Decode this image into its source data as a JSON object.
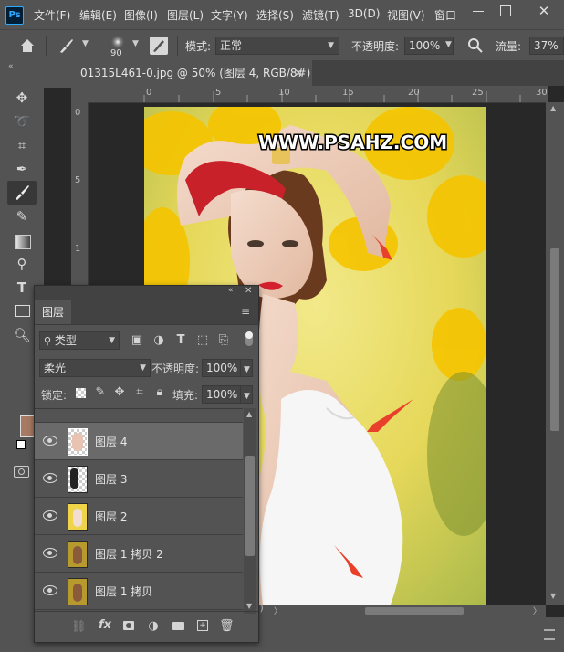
{
  "app": {
    "logo": "Ps"
  },
  "menu": [
    "文件(F)",
    "编辑(E)",
    "图像(I)",
    "图层(L)",
    "文字(Y)",
    "选择(S)",
    "滤镜(T)",
    "3D(D)",
    "视图(V)",
    "窗口"
  ],
  "window_controls": {
    "close": "✕"
  },
  "options_bar": {
    "brush_size": "90",
    "mode_label": "模式:",
    "mode_value": "正常",
    "opacity_label": "不透明度:",
    "opacity_value": "100%",
    "flow_label": "流量:",
    "flow_value": "37%"
  },
  "document": {
    "tab_title": "01315L461-0.jpg @ 50% (图层 4, RGB/8#) *",
    "ruler_h": [
      "0",
      "5",
      "10",
      "15",
      "20",
      "25",
      "30"
    ],
    "ruler_v": [
      "0",
      "5",
      "1",
      "1"
    ],
    "watermark": "WWW.PSAHZ.COM",
    "status_fragment": "i)"
  },
  "layers_panel": {
    "tab": "图层",
    "filter_label": "类型",
    "blend_mode": "柔光",
    "opacity_label": "不透明度:",
    "opacity_value": "100%",
    "lock_label": "锁定:",
    "fill_label": "填充:",
    "fill_value": "100%",
    "layers": [
      {
        "name": "图层 4",
        "selected": true
      },
      {
        "name": "图层 3",
        "selected": false
      },
      {
        "name": "图层 2",
        "selected": false
      },
      {
        "name": "图层 1 拷贝 2",
        "selected": false
      },
      {
        "name": "图层 1 拷贝",
        "selected": false
      }
    ]
  },
  "colors": {
    "ui_bg": "#535353",
    "canvas_bg": "#282828",
    "foreground_swatch": "#a87a63",
    "arrow": "#e8402a"
  }
}
